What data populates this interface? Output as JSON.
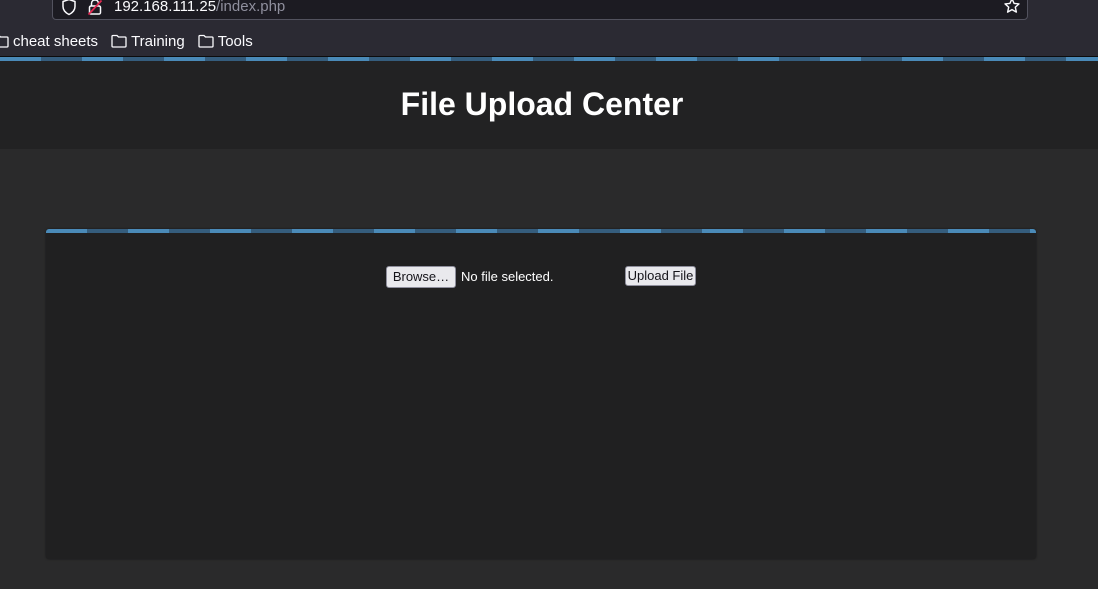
{
  "browser": {
    "url_host": "192.168.111.25",
    "url_path": "/index.php",
    "icons": [
      "shield-icon",
      "lock-broken-icon",
      "star-icon"
    ],
    "bookmarks": [
      {
        "label": "cheat sheets",
        "icon": "folder-icon"
      },
      {
        "label": "Training",
        "icon": "folder-icon"
      },
      {
        "label": "Tools",
        "icon": "folder-icon"
      }
    ]
  },
  "page": {
    "title": "File Upload Center",
    "stripe_colors": [
      "#4a8ab8",
      "#355d7d"
    ]
  },
  "form": {
    "browse_label": "Browse…",
    "file_status": "No file selected.",
    "upload_label": "Upload File"
  }
}
